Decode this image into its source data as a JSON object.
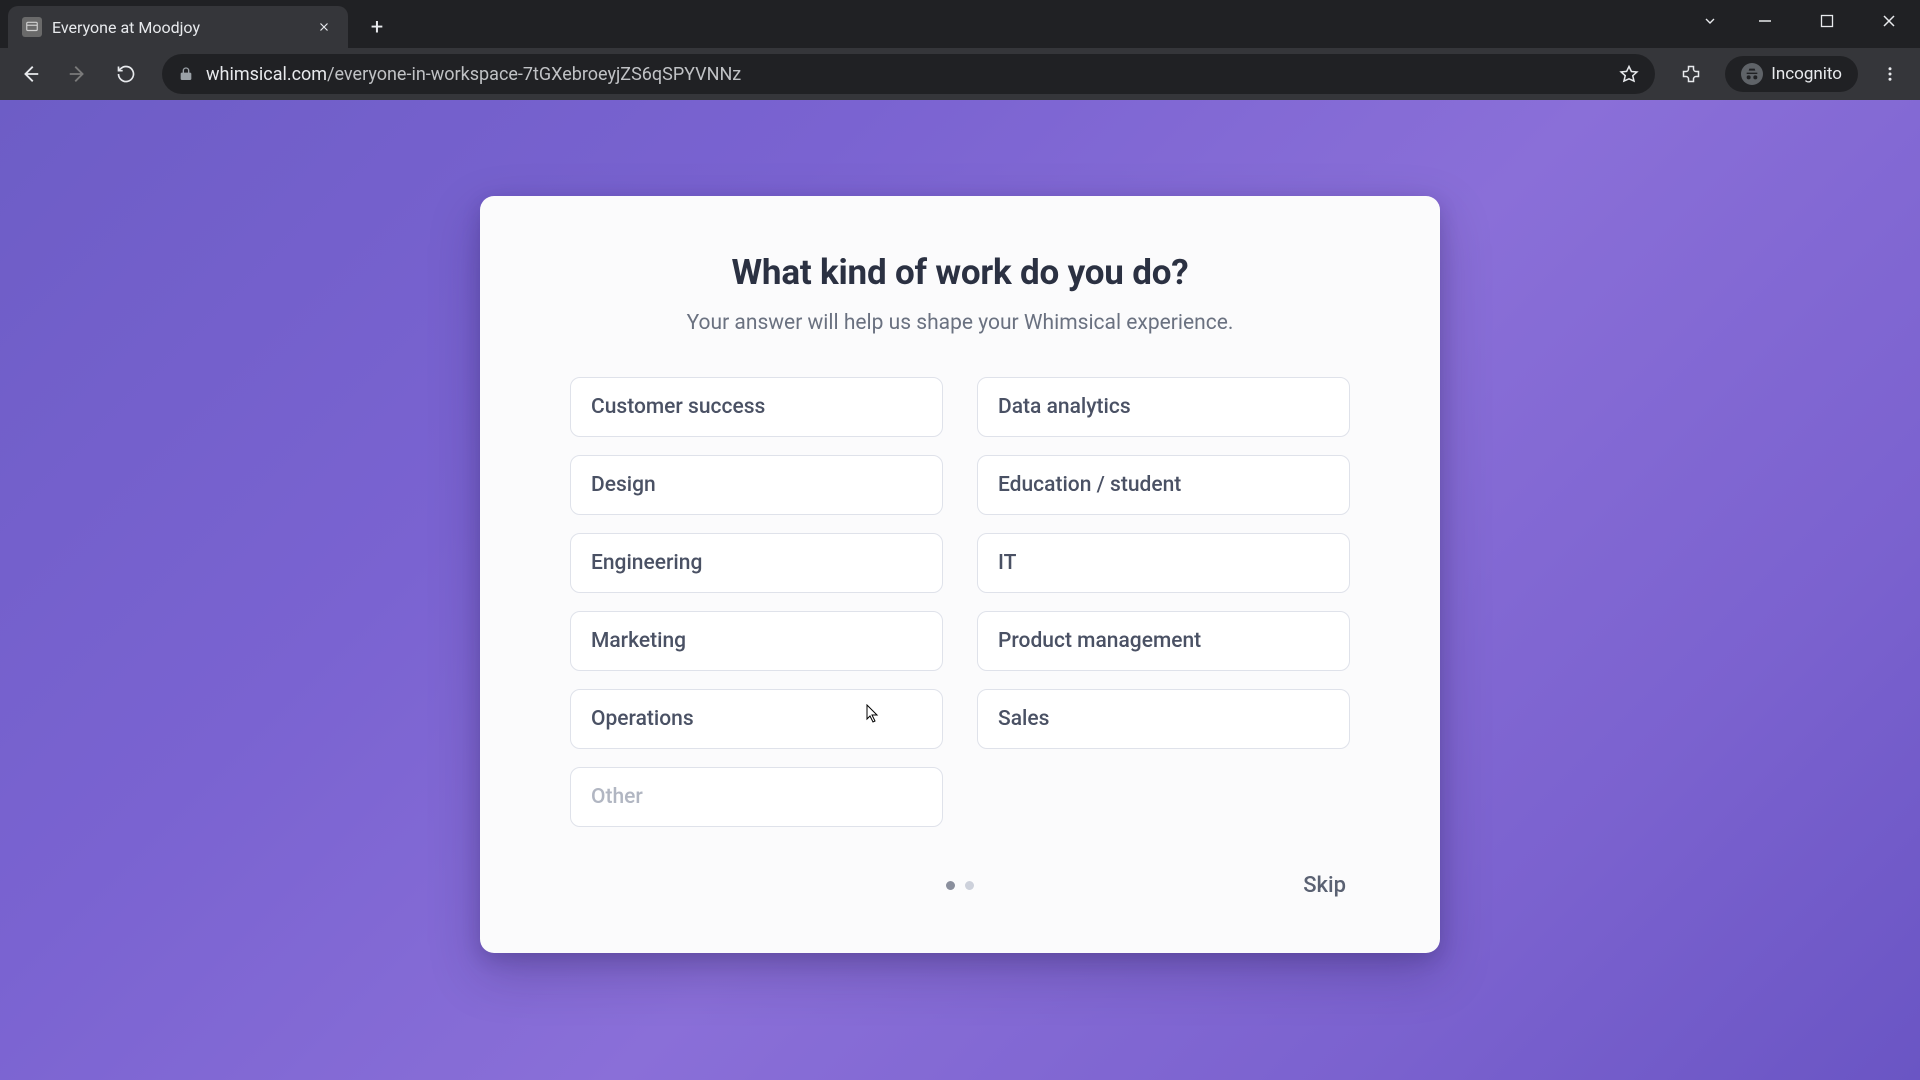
{
  "browser": {
    "tab_title": "Everyone at Moodjoy",
    "url_host": "whimsical.com",
    "url_path": "/everyone-in-workspace-7tGXebroeyjZS6qSPYVNNz",
    "incognito_label": "Incognito"
  },
  "modal": {
    "title": "What kind of work do you do?",
    "subtitle": "Your answer will help us shape your Whimsical experience.",
    "options": {
      "o0": "Customer success",
      "o1": "Data analytics",
      "o2": "Design",
      "o3": "Education / student",
      "o4": "Engineering",
      "o5": "IT",
      "o6": "Marketing",
      "o7": "Product management",
      "o8": "Operations",
      "o9": "Sales",
      "o10": "Other"
    },
    "skip_label": "Skip"
  }
}
